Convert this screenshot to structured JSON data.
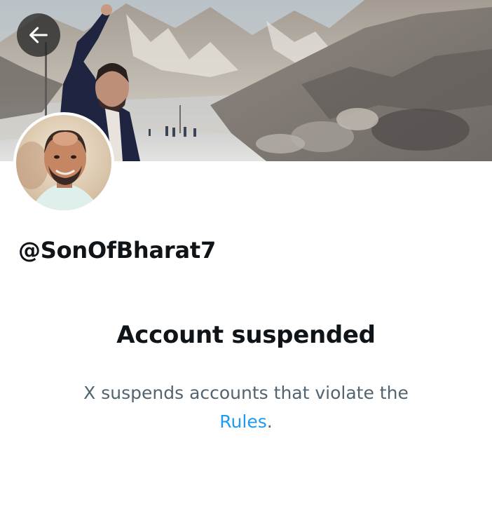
{
  "profile": {
    "handle": "@SonOfBharat7"
  },
  "navigation": {
    "back_icon": "arrow-left-icon"
  },
  "notice": {
    "title": "Account suspended",
    "body_text": "X suspends accounts that violate the",
    "link_text": "Rules",
    "trailing_punctuation": "."
  },
  "colors": {
    "text_primary": "#0f1419",
    "text_secondary": "#536471",
    "link": "#1d9bf0"
  }
}
